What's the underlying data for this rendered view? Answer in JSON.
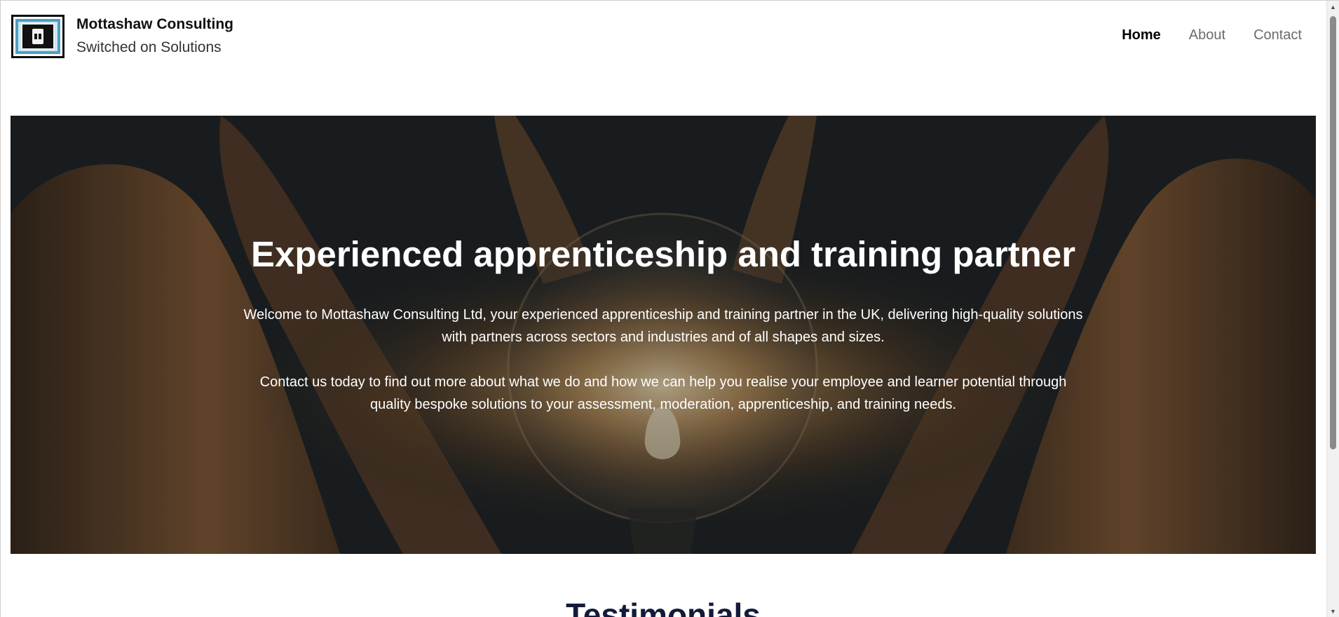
{
  "header": {
    "brand_name": "Mottashaw Consulting",
    "tagline": "Switched on Solutions"
  },
  "nav": {
    "items": [
      {
        "label": "Home",
        "active": true
      },
      {
        "label": "About",
        "active": false
      },
      {
        "label": "Contact",
        "active": false
      }
    ]
  },
  "hero": {
    "title": "Experienced apprenticeship and training partner",
    "paragraph_1": "Welcome to Mottashaw Consulting Ltd, your experienced apprenticeship and training partner in the UK, delivering high-quality solutions with partners across sectors and industries and of all shapes and sizes.",
    "paragraph_2": "Contact us today to find out more about what we do and how we can help you realise your employee and learner potential through quality bespoke solutions to your assessment, moderation, apprenticeship, and training needs."
  },
  "testimonials": {
    "title": "Testimonials"
  },
  "icons": {
    "logo": "plug-logo-icon",
    "scroll_up": "scroll-up-arrow-icon",
    "scroll_down": "scroll-down-arrow-icon"
  },
  "colors": {
    "nav_active": "#000000",
    "nav_inactive": "#6b6b6b",
    "section_title": "#141a3a",
    "hero_text": "#ffffff"
  }
}
